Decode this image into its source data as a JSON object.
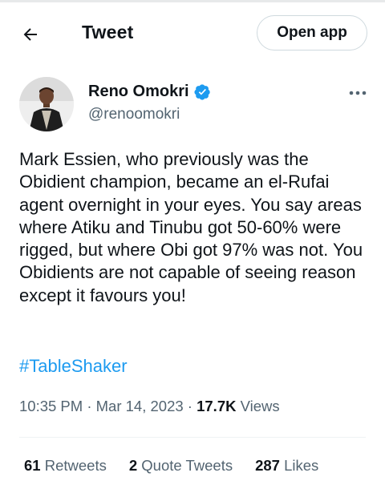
{
  "header": {
    "title": "Tweet",
    "open_app_label": "Open app",
    "back_icon": "arrow-left-icon"
  },
  "author": {
    "name": "Reno Omokri",
    "handle": "@renoomokri",
    "verified_color": "#1d9bf0"
  },
  "tweet": {
    "text": "Mark Essien, who previously was the Obidient champion, became an el-Rufai agent overnight in your eyes. You say areas where Atiku and Tinubu got 50-60% were rigged, but where Obi got 97% was not. You Obidients are not capable of seeing reason except it favours you!",
    "hashtag": "#TableShaker"
  },
  "meta": {
    "time": "10:35 PM",
    "separator": "·",
    "date": "Mar 14, 2023",
    "views_count": "17.7K",
    "views_label": "Views"
  },
  "stats": {
    "retweets_count": "61",
    "retweets_label": "Retweets",
    "quotes_count": "2",
    "quotes_label": "Quote Tweets",
    "likes_count": "287",
    "likes_label": "Likes"
  },
  "colors": {
    "accent": "#1d9bf0",
    "secondary_text": "#536471",
    "primary_text": "#0f1419"
  }
}
